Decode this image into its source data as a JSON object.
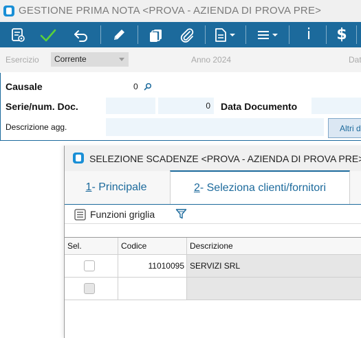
{
  "main_window": {
    "title": "GESTIONE PRIMA NOTA <PROVA - AZIENDA DI PROVA PRE>",
    "toolbar": {
      "info_label": "i",
      "currency_label": "$"
    },
    "filters": {
      "esercizio_label": "Esercizio",
      "esercizio_value": "Corrente",
      "anno_label": "Anno 2024",
      "date_label_partial": "Dat"
    },
    "form": {
      "causale_label": "Causale",
      "causale_value": "0",
      "serie_label": "Serie/num. Doc.",
      "num_doc_value": "0",
      "data_documento_label": "Data Documento",
      "descrizione_label": "Descrizione agg.",
      "altri_button_partial": "Altri d"
    }
  },
  "child_window": {
    "title": "SELEZIONE SCADENZE <PROVA - AZIENDA DI PROVA PRE>",
    "tabs": [
      {
        "key": "1",
        "label": "- Principale"
      },
      {
        "key": "2",
        "label": "- Seleziona clienti/fornitori"
      }
    ],
    "grid_toolbar": {
      "funzioni_label": "Funzioni griglia"
    },
    "grid": {
      "columns": [
        "Sel.",
        "Codice",
        "Descrizione"
      ],
      "rows": [
        {
          "codice": "11010095",
          "descrizione": "SERVIZI SRL"
        },
        {
          "codice": "",
          "descrizione": ""
        }
      ]
    }
  },
  "colors": {
    "accent": "#1c6a9c",
    "field_bg": "#edf5fb",
    "check_green": "#5ad13a"
  }
}
